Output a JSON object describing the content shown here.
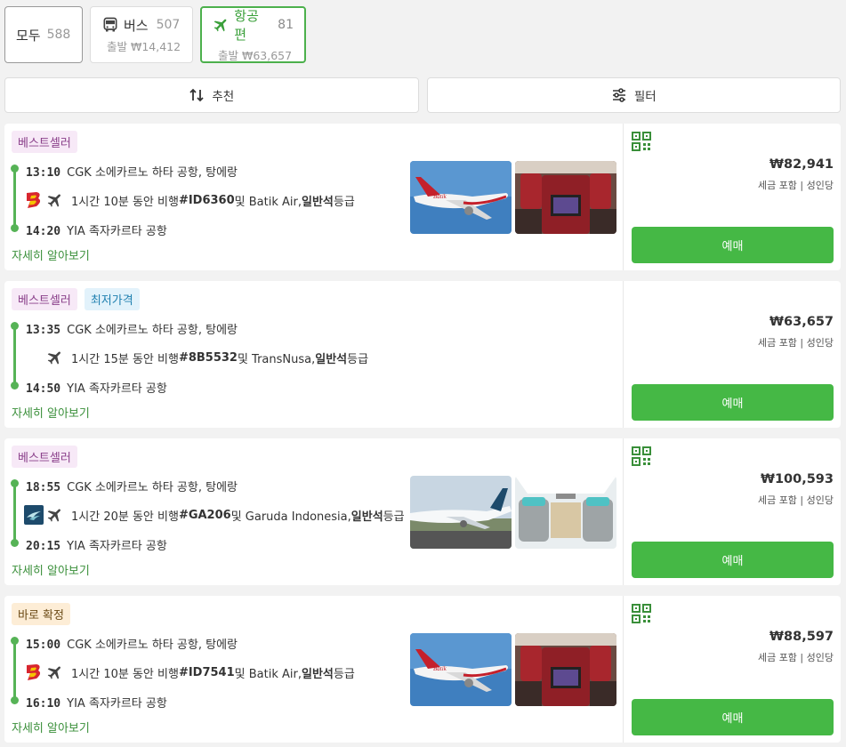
{
  "tabs": {
    "all": {
      "label": "모두",
      "count": "588"
    },
    "bus": {
      "label": "버스",
      "count": "507",
      "sub": "출발 ₩14,412"
    },
    "flight": {
      "label": "항공편",
      "count": "81",
      "sub": "출발 ₩63,657"
    }
  },
  "toolbar": {
    "sort_label": "추천",
    "filter_label": "필터"
  },
  "colors": {
    "accent": "#45b845",
    "timeline": "#56b356",
    "link": "#3a8f3a"
  },
  "results": [
    {
      "badges": [
        "베스트셀러"
      ],
      "dep_time": "13:10",
      "dep_place": "CGK 소에카르노 하타 공항, 탕에랑",
      "arr_time": "14:20",
      "arr_place": "YIA 족자카르타 공항",
      "dur": "1시간 10분 동안 비행 ",
      "flight_no": "#ID6360",
      "airline": " 및 Batik Air, ",
      "cls": "일반석",
      "cls_suffix": "등급",
      "details": "자세히 알아보기",
      "price": "₩82,941",
      "tax_note": "세금 포함 | 성인당",
      "book": "예매"
    },
    {
      "badges": [
        "베스트셀러",
        "최저가격"
      ],
      "dep_time": "13:35",
      "dep_place": "CGK 소에카르노 하타 공항, 탕에랑",
      "arr_time": "14:50",
      "arr_place": "YIA 족자카르타 공항",
      "dur": "1시간 15분 동안 비행 ",
      "flight_no": "#8B5532",
      "airline": " 및 TransNusa, ",
      "cls": "일반석",
      "cls_suffix": "등급",
      "details": "자세히 알아보기",
      "price": "₩63,657",
      "tax_note": "세금 포함 | 성인당",
      "book": "예매"
    },
    {
      "badges": [
        "베스트셀러"
      ],
      "dep_time": "18:55",
      "dep_place": "CGK 소에카르노 하타 공항, 탕에랑",
      "arr_time": "20:15",
      "arr_place": "YIA 족자카르타 공항",
      "dur": "1시간 20분 동안 비행 ",
      "flight_no": "#GA206",
      "airline": " 및 Garuda Indonesia, ",
      "cls": "일반석",
      "cls_suffix": "등급",
      "details": "자세히 알아보기",
      "price": "₩100,593",
      "tax_note": "세금 포함 | 성인당",
      "book": "예매"
    },
    {
      "badges": [
        "바로 확정"
      ],
      "dep_time": "15:00",
      "dep_place": "CGK 소에카르노 하타 공항, 탕에랑",
      "arr_time": "16:10",
      "arr_place": "YIA 족자카르타 공항",
      "dur": "1시간 10분 동안 비행 ",
      "flight_no": "#ID7541",
      "airline": " 및 Batik Air, ",
      "cls": "일반석",
      "cls_suffix": "등급",
      "details": "자세히 알아보기",
      "price": "₩88,597",
      "tax_note": "세금 포함 | 성인당",
      "book": "예매"
    }
  ]
}
